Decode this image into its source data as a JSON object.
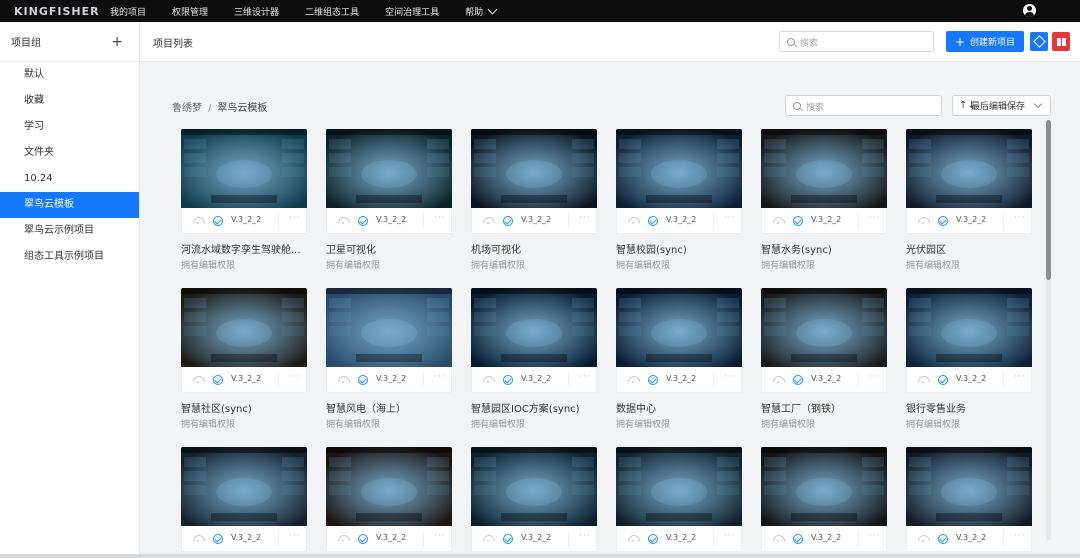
{
  "topnav": {
    "logo": "KINGFISHER",
    "items": [
      "我的项目",
      "权限管理",
      "三维设计器",
      "二维组态工具",
      "空间治理工具"
    ],
    "help": "帮助"
  },
  "sidebar": {
    "title": "项目组",
    "add_icon": "+",
    "items": [
      {
        "label": "默认",
        "active": false
      },
      {
        "label": "收藏",
        "active": false
      },
      {
        "label": "学习",
        "active": false
      },
      {
        "label": "文件夹",
        "active": false
      },
      {
        "label": "10.24",
        "active": false
      },
      {
        "label": "翠鸟云模板",
        "active": true
      },
      {
        "label": "翠鸟云示例项目",
        "active": false
      },
      {
        "label": "组态工具示例项目",
        "active": false
      }
    ]
  },
  "header": {
    "title": "项目列表",
    "search_placeholder": "搜索",
    "create_label": "创建新项目",
    "create_icon": "+"
  },
  "content": {
    "breadcrumb": [
      "鲁绣梦",
      "翠鸟云模板"
    ],
    "search_placeholder": "搜索",
    "sort_label": "最后编辑保存",
    "sort_icon": "↑↓"
  },
  "cards": [
    {
      "name": "河流水域数字孪生驾驶舱...",
      "version": "V.3_2_2",
      "perm": "拥有编辑权限",
      "color": "#0f3a4a"
    },
    {
      "name": "卫星可视化",
      "version": "V.3_2_2",
      "perm": "拥有编辑权限",
      "color": "#0c2226"
    },
    {
      "name": "机场可视化",
      "version": "V.3_2_2",
      "perm": "拥有编辑权限",
      "color": "#0b1420"
    },
    {
      "name": "智慧校园(sync)",
      "version": "V.3_2_2",
      "perm": "拥有编辑权限",
      "color": "#0d1f35"
    },
    {
      "name": "智慧水务(sync)",
      "version": "V.3_2_2",
      "perm": "拥有编辑权限",
      "color": "#161616"
    },
    {
      "name": "光伏园区",
      "version": "V.3_2_2",
      "perm": "拥有编辑权限",
      "color": "#111a2b"
    },
    {
      "name": "智慧社区(sync)",
      "version": "V.3_2_2",
      "perm": "拥有编辑权限",
      "color": "#1e1a14"
    },
    {
      "name": "智慧风电（海上）",
      "version": "V.3_2_2",
      "perm": "拥有编辑权限",
      "color": "#2a4a6a"
    },
    {
      "name": "智慧园区IOC方案(sync)",
      "version": "V.3_2_2",
      "perm": "拥有编辑权限",
      "color": "#071a2e"
    },
    {
      "name": "数据中心",
      "version": "V.3_2_2",
      "perm": "拥有编辑权限",
      "color": "#0a1c33"
    },
    {
      "name": "智慧工厂（钢铁）",
      "version": "V.3_2_2",
      "perm": "拥有编辑权限",
      "color": "#1a1a1a"
    },
    {
      "name": "银行零售业务",
      "version": "V.3_2_2",
      "perm": "拥有编辑权限",
      "color": "#0d2238"
    },
    {
      "name": "",
      "version": "V.3_2_2",
      "perm": "",
      "color": "#14202c"
    },
    {
      "name": "",
      "version": "V.3_2_2",
      "perm": "",
      "color": "#1c1512"
    },
    {
      "name": "",
      "version": "V.3_2_2",
      "perm": "",
      "color": "#0b1f2c"
    },
    {
      "name": "",
      "version": "V.3_2_2",
      "perm": "",
      "color": "#10212a"
    },
    {
      "name": "",
      "version": "V.3_2_2",
      "perm": "",
      "color": "#131313"
    },
    {
      "name": "",
      "version": "V.3_2_2",
      "perm": "",
      "color": "#141a24"
    }
  ]
}
